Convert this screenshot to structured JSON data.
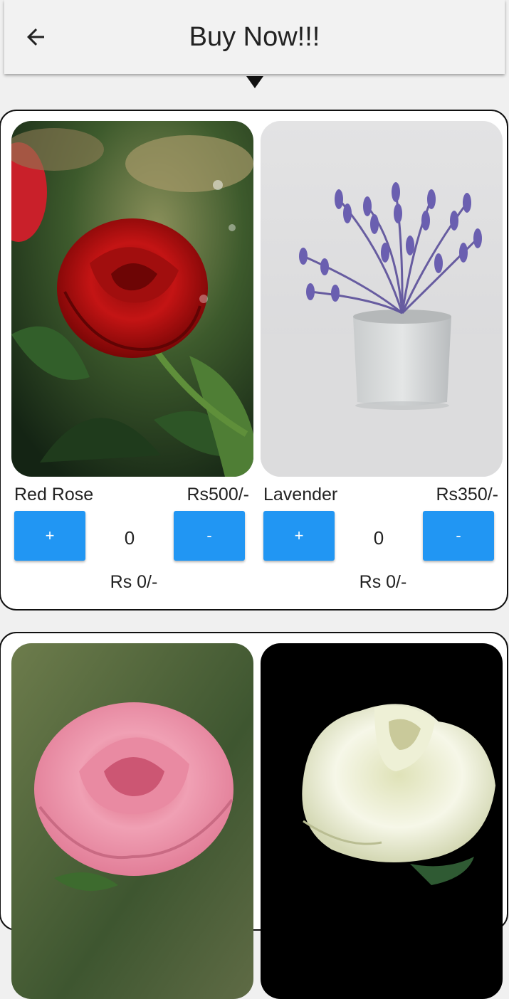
{
  "appbar": {
    "title": "Buy Now!!!",
    "back_icon": "arrow-left-icon"
  },
  "products": [
    {
      "name": "Red Rose",
      "price": "Rs500/-",
      "plus_label": "+",
      "minus_label": "-",
      "quantity": "0",
      "total": "Rs 0/-",
      "image": "red-rose-photo"
    },
    {
      "name": "Lavender",
      "price": "Rs350/-",
      "plus_label": "+",
      "minus_label": "-",
      "quantity": "0",
      "total": "Rs 0/-",
      "image": "lavender-pot-photo"
    },
    {
      "image": "pink-rose-photo"
    },
    {
      "image": "white-rose-photo"
    }
  ],
  "colors": {
    "accent": "#2196f3",
    "background": "#f0f0f0",
    "card": "#ffffff",
    "card_border": "#111111"
  }
}
